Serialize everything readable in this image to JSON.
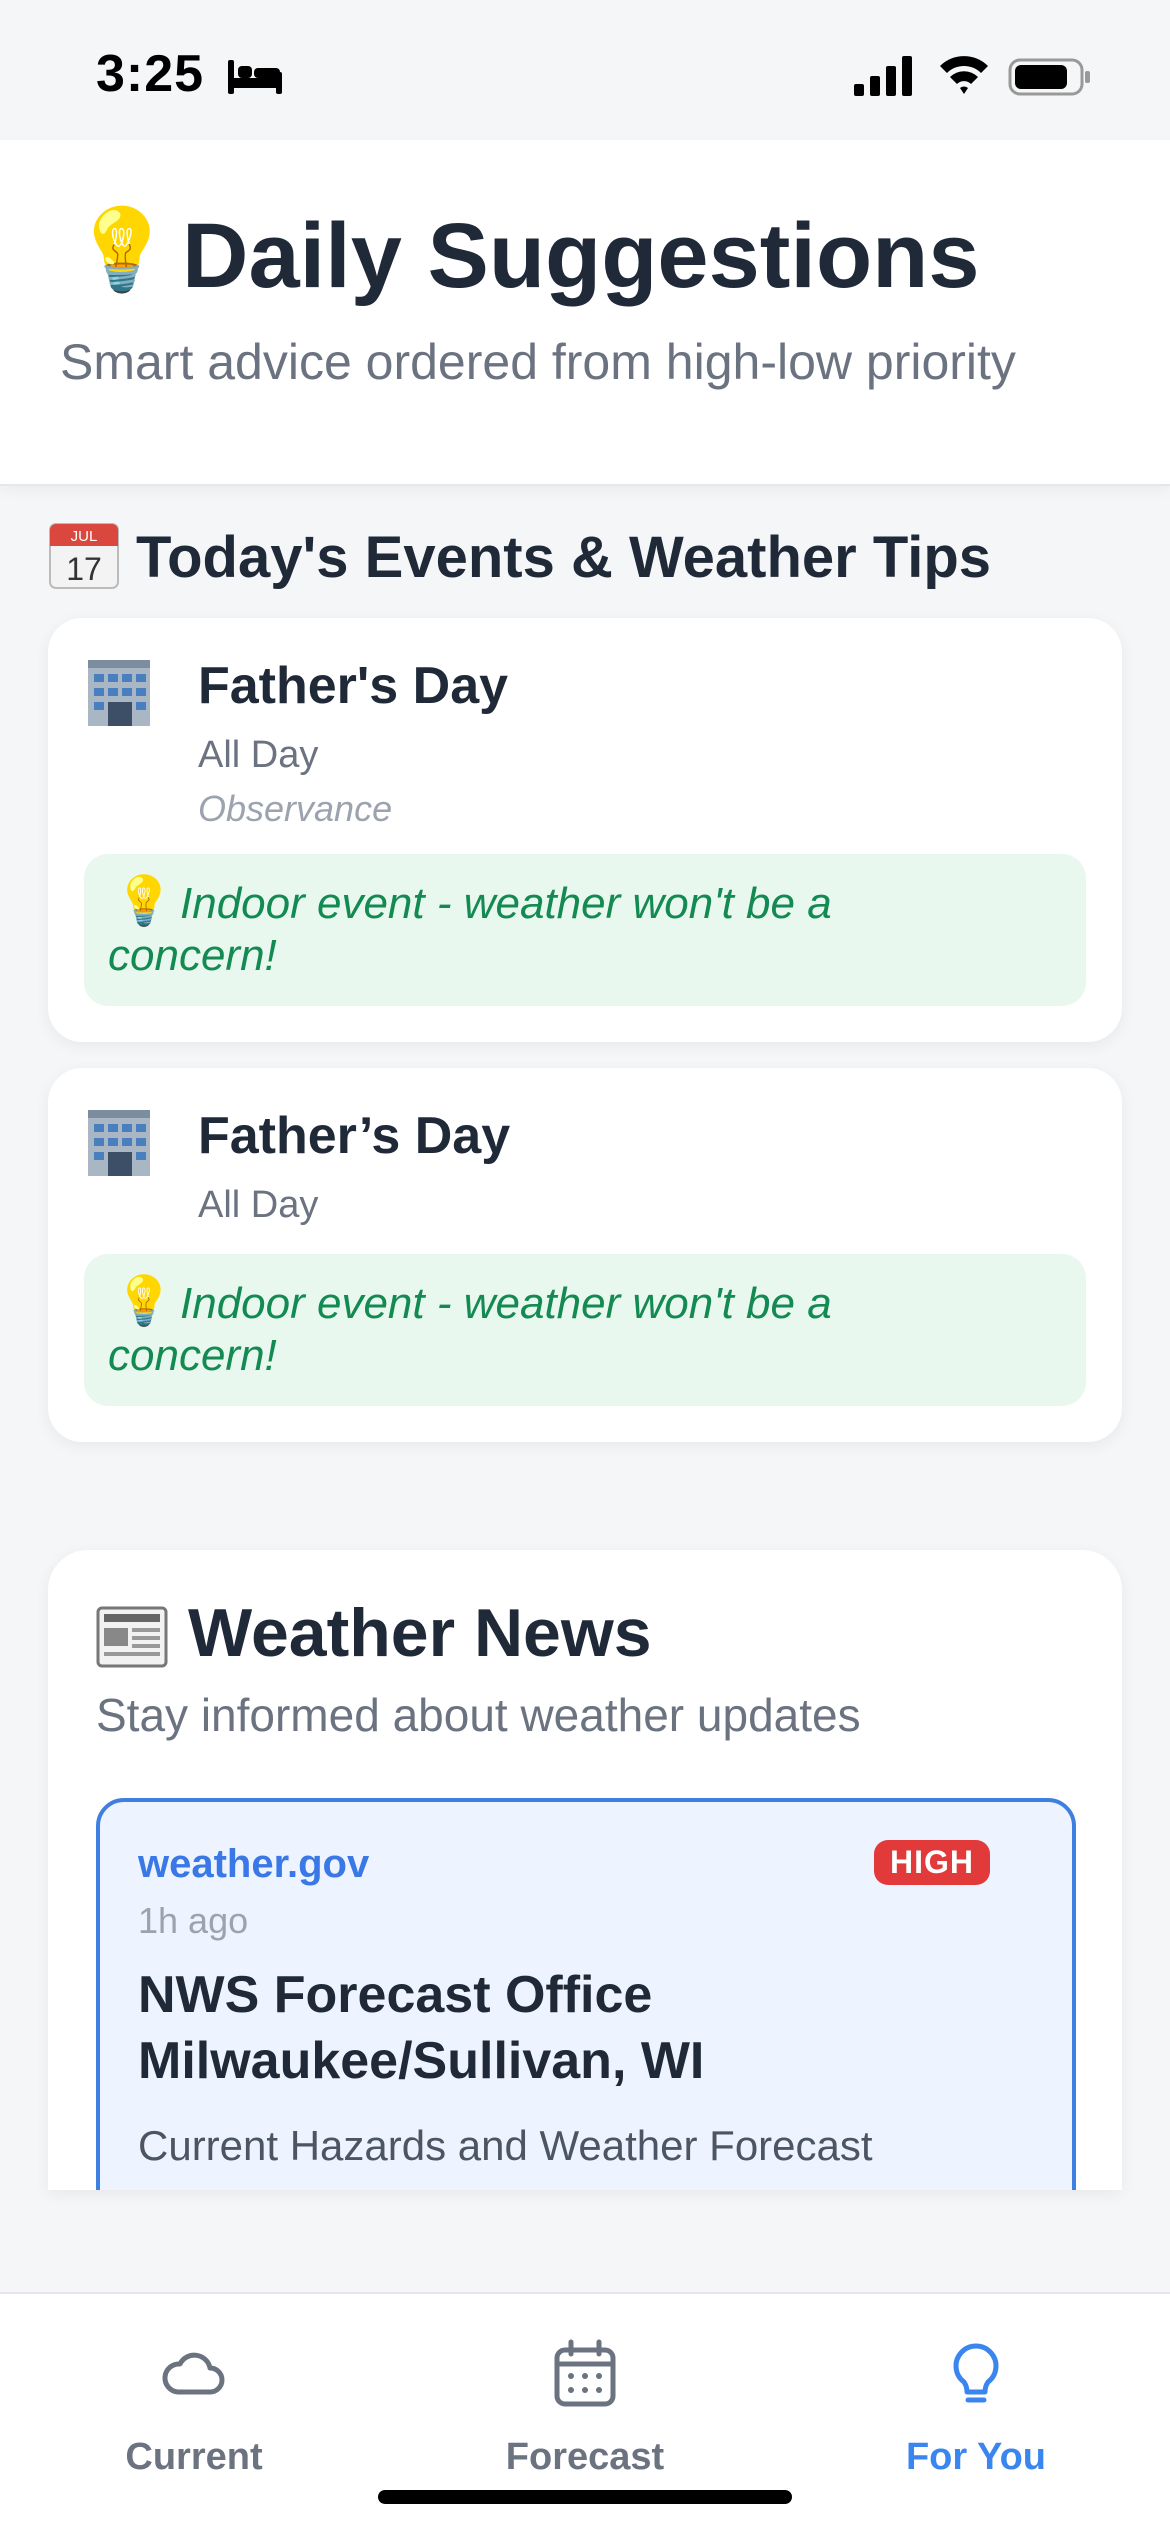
{
  "status_bar": {
    "time": "3:25"
  },
  "header": {
    "emoji": "💡",
    "title": "Daily Suggestions",
    "subtitle": "Smart advice ordered from high-low priority"
  },
  "events_section": {
    "title": "Today's Events & Weather Tips",
    "calendar_month": "JUL",
    "calendar_day": "17",
    "events": [
      {
        "title": "Father's Day",
        "time": "All Day",
        "type": "Observance",
        "tip_emoji": "💡",
        "tip": "Indoor event - weather won't be a concern!"
      },
      {
        "title": "Father’s Day",
        "time": "All Day",
        "tip_emoji": "💡",
        "tip": "Indoor event - weather won't be a concern!"
      }
    ]
  },
  "news": {
    "title": "Weather News",
    "subtitle": "Stay informed about weather updates",
    "articles": [
      {
        "source": "weather.gov",
        "priority": "HIGH",
        "age": "1h ago",
        "title": "NWS Forecast Office Milwaukee/Sullivan, WI",
        "description": "Current Hazards and Weather Forecast"
      }
    ]
  },
  "tabs": [
    {
      "label": "Current",
      "icon": "cloud-icon",
      "active": false
    },
    {
      "label": "Forecast",
      "icon": "calendar-icon",
      "active": false
    },
    {
      "label": "For You",
      "icon": "lightbulb-icon",
      "active": true
    }
  ],
  "colors": {
    "accent": "#3a86ee",
    "tip_green": "#138a52",
    "tip_bg": "#e9f8ef",
    "badge_red": "#e23a3a"
  }
}
